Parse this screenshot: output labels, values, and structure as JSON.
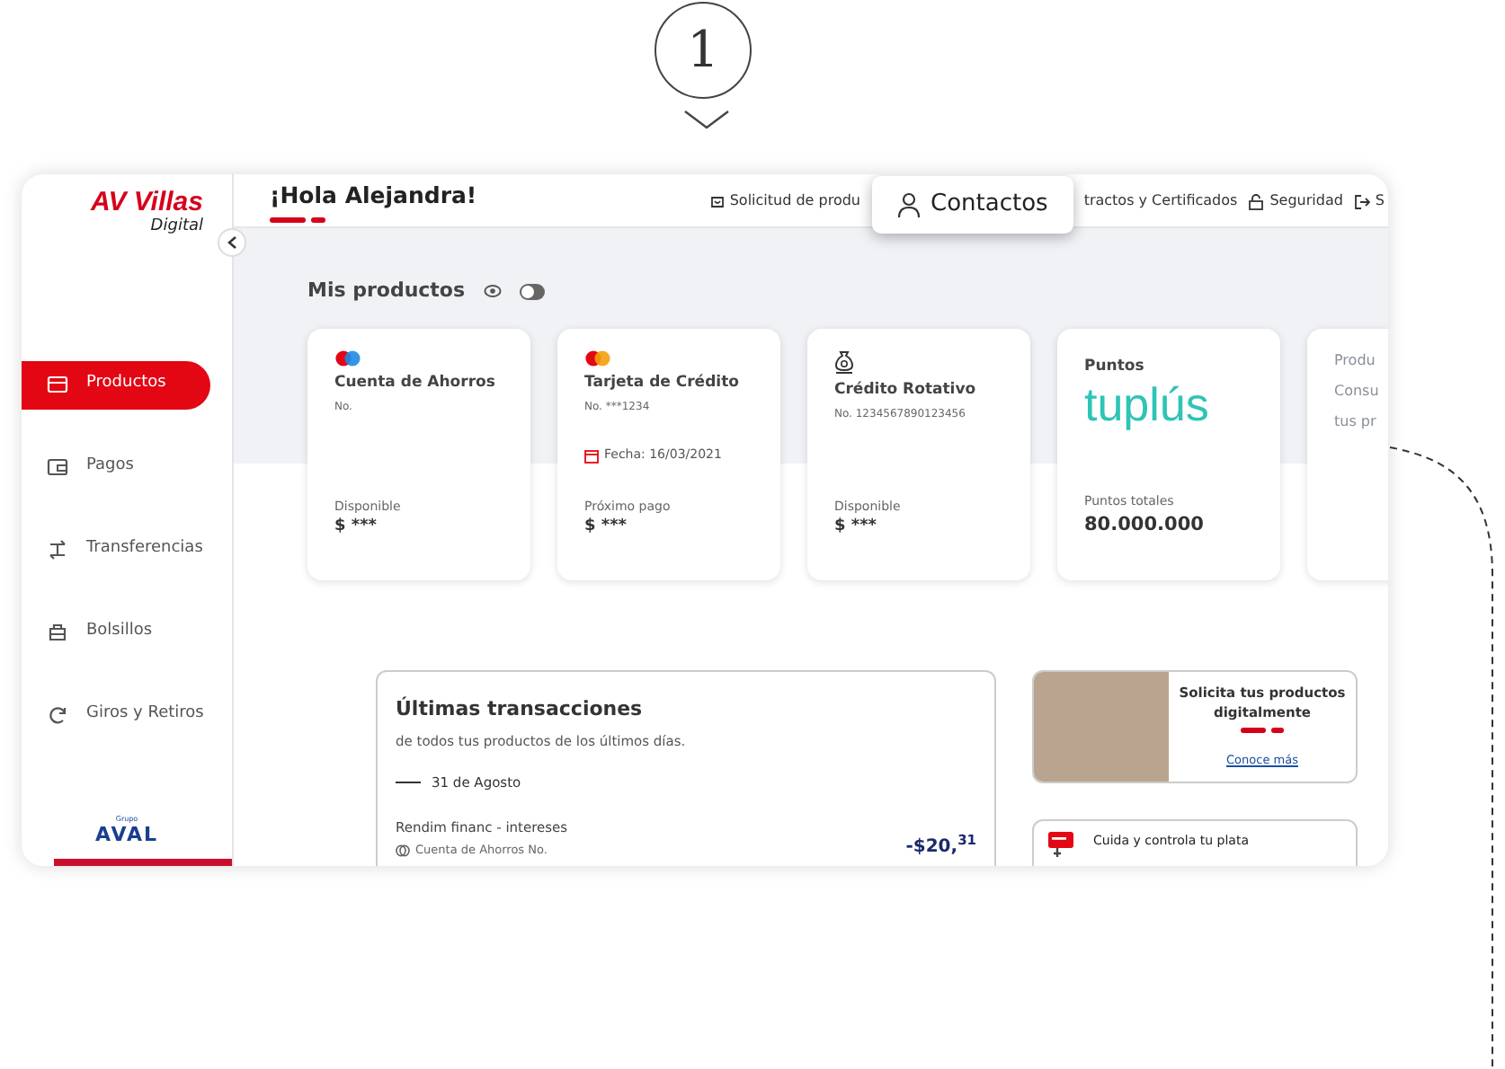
{
  "annotation": {
    "step": "1"
  },
  "sidebar": {
    "logo": {
      "name": "AV Villas",
      "sub": "Digital"
    },
    "items": [
      {
        "label": "Productos",
        "selected": true
      },
      {
        "label": "Pagos",
        "selected": false
      },
      {
        "label": "Transferencias",
        "selected": false
      },
      {
        "label": "Bolsillos",
        "selected": false
      },
      {
        "label": "Giros y Retiros",
        "selected": false
      }
    ],
    "footer": {
      "group": "Grupo",
      "brand": "AVAL"
    }
  },
  "header": {
    "greeting": "¡Hola Alejandra!",
    "nav": [
      {
        "label": "Solicitud de produ",
        "selected": false
      },
      {
        "label": "Contactos",
        "selected": true
      },
      {
        "label": "tractos y Certificados",
        "selected": false
      },
      {
        "label": "Seguridad",
        "selected": false
      },
      {
        "label": "S",
        "selected": false
      }
    ]
  },
  "products": {
    "title": "Mis productos",
    "balances_visible": false,
    "cards": [
      {
        "kind": "savings",
        "title": "Cuenta de Ahorros",
        "number": "No.",
        "amount_label": "Disponible",
        "amount": "$ ***"
      },
      {
        "kind": "credit",
        "title": "Tarjeta de Crédito",
        "number": "No. ***1234",
        "date": "Fecha: 16/03/2021",
        "amount_label": "Próximo pago",
        "amount": "$ ***"
      },
      {
        "kind": "rotating",
        "title": "Crédito Rotativo",
        "number": "No. 1234567890123456",
        "amount_label": "Disponible",
        "amount": "$ ***"
      },
      {
        "kind": "points",
        "title": "Puntos",
        "brand": "tuplús",
        "amount_label": "Puntos totales",
        "amount": "80.000.000"
      },
      {
        "kind": "partial",
        "lines": [
          "Produ",
          "Consu",
          "tus pr"
        ]
      }
    ]
  },
  "transactions": {
    "title": "Últimas transacciones",
    "subtitle": "de todos tus productos de los últimos días.",
    "date": "31 de Agosto",
    "items": [
      {
        "description": "Rendim financ - intereses",
        "account": "Cuenta de Ahorros No.",
        "amount": "-$20,$^{31}$"
      }
    ]
  },
  "promo": {
    "title": "Solicita tus productos digitalmente",
    "link": "Conoce más"
  },
  "tip": {
    "title": "Cuida y controla tu plata"
  }
}
